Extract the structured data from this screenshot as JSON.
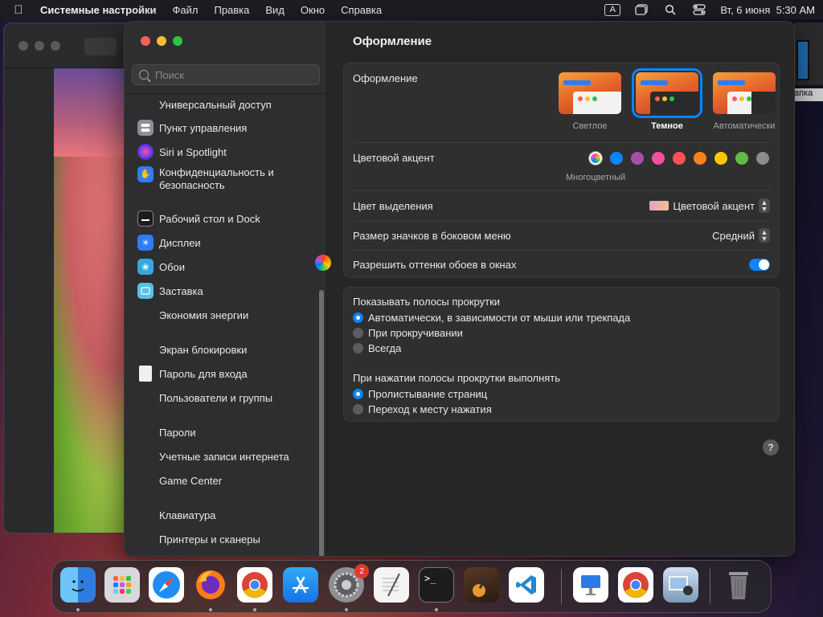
{
  "menubar": {
    "app": "Системные настройки",
    "items": [
      "Файл",
      "Правка",
      "Вид",
      "Окно",
      "Справка"
    ],
    "input_source": "A",
    "clock": "Вт, 6 июня  5:30 AM"
  },
  "background": {
    "folder_label": "апка"
  },
  "sidebar": {
    "search_placeholder": "Поиск",
    "items": [
      {
        "label": "Универсальный доступ",
        "icon": "accessibility-icon"
      },
      {
        "label": "Пункт управления",
        "icon": "control-center-icon",
        "color": "#8e8e93"
      },
      {
        "label": "Siri и Spotlight",
        "icon": "siri-icon",
        "color": "#a04cdc"
      },
      {
        "label": "Конфиденциальность и безопасность",
        "icon": "privacy-hand-icon",
        "color": "#2f7cf6"
      },
      {
        "label": "Рабочий стол и Dock",
        "icon": "desktop-dock-icon",
        "color": "#1c1c1e"
      },
      {
        "label": "Дисплеи",
        "icon": "displays-icon",
        "color": "#2f7cf6"
      },
      {
        "label": "Обои",
        "icon": "wallpaper-icon",
        "color": "#35a7e0"
      },
      {
        "label": "Заставка",
        "icon": "screensaver-icon",
        "color": "#56c1e6"
      },
      {
        "label": "Экономия энергии",
        "icon": "energy-icon"
      },
      {
        "label": "Экран блокировки",
        "icon": "lock-screen-icon"
      },
      {
        "label": "Пароль для входа",
        "icon": "login-password-icon",
        "color": "#e8e8e8"
      },
      {
        "label": "Пользователи и группы",
        "icon": "users-icon"
      },
      {
        "label": "Пароли",
        "icon": "passwords-icon"
      },
      {
        "label": "Учетные записи интернета",
        "icon": "internet-accounts-icon"
      },
      {
        "label": "Game Center",
        "icon": "game-center-icon"
      },
      {
        "label": "Клавиатура",
        "icon": "keyboard-icon"
      },
      {
        "label": "Принтеры и сканеры",
        "icon": "printers-icon"
      }
    ]
  },
  "content": {
    "title": "Оформление",
    "appearance": {
      "label": "Оформление",
      "options": [
        {
          "label": "Светлое",
          "selected": false
        },
        {
          "label": "Темное",
          "selected": true
        },
        {
          "label": "Автоматически",
          "selected": false
        }
      ]
    },
    "accent": {
      "label": "Цветовой акцент",
      "caption": "Многоцветный",
      "colors": [
        "multicolor",
        "#0a84ff",
        "#a550a7",
        "#f74f9e",
        "#ff5257",
        "#f7821b",
        "#ffc600",
        "#62ba46",
        "#8c8c8c"
      ]
    },
    "highlight": {
      "label": "Цвет выделения",
      "value": "Цветовой акцент"
    },
    "sidebar_icon_size": {
      "label": "Размер значков в боковом меню",
      "value": "Средний"
    },
    "wallpaper_tinting": {
      "label": "Разрешить оттенки обоев в окнах",
      "enabled": true
    },
    "scrollbars": {
      "label": "Показывать полосы прокрутки",
      "options": [
        {
          "label": "Автоматически, в зависимости от мыши или трекпада",
          "selected": true
        },
        {
          "label": "При прокручивании",
          "selected": false
        },
        {
          "label": "Всегда",
          "selected": false
        }
      ]
    },
    "click_scroll": {
      "label": "При нажатии полосы прокрутки выполнять",
      "options": [
        {
          "label": "Пролистывание страниц",
          "selected": true
        },
        {
          "label": "Переход к месту нажатия",
          "selected": false
        }
      ]
    },
    "help": "?"
  },
  "dock": {
    "apps": [
      {
        "name": "finder-icon",
        "color": "#3d9bf0"
      },
      {
        "name": "launchpad-icon",
        "color": "#c8c8cc"
      },
      {
        "name": "safari-icon",
        "color": "#2f8cf0"
      },
      {
        "name": "firefox-icon",
        "color": "#7a2fbf"
      },
      {
        "name": "chrome-icon",
        "color": "#f2f2f2"
      },
      {
        "name": "app-store-icon",
        "color": "#2a8af5"
      },
      {
        "name": "system-settings-icon",
        "color": "#8e8e93",
        "badge": "2"
      },
      {
        "name": "textedit-icon",
        "color": "#f4f4f4"
      },
      {
        "name": "terminal-icon",
        "color": "#1c1c1e"
      },
      {
        "name": "garageband-icon",
        "color": "#3a2a20"
      },
      {
        "name": "vscode-icon",
        "color": "#ffffff"
      },
      {
        "name": "keynote-icon",
        "color": "#2a7ae8"
      },
      {
        "name": "chrome-icon-2",
        "color": "#f2f2f2"
      },
      {
        "name": "preview-icon",
        "color": "#9ab8d8"
      },
      {
        "name": "trash-icon",
        "color": "#6a6a6e"
      }
    ]
  }
}
